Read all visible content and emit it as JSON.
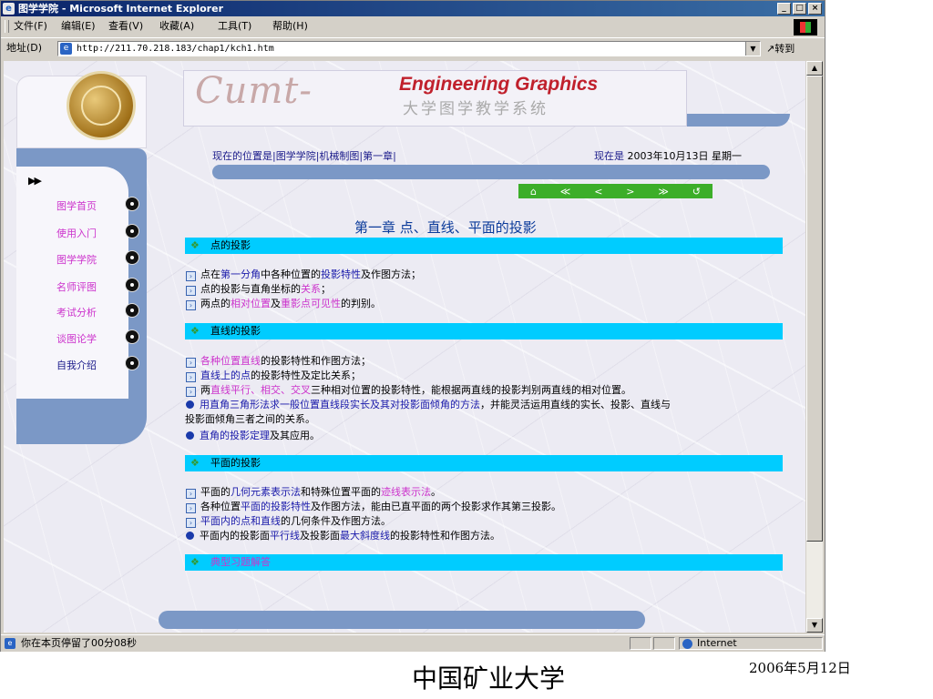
{
  "window": {
    "title": "图学学院 - Microsoft Internet Explorer",
    "min": "_",
    "max": "□",
    "close": "×"
  },
  "menu": [
    "文件(F)",
    "编辑(E)",
    "查看(V)",
    "收藏(A)",
    "工具(T)",
    "帮助(H)"
  ],
  "address": {
    "label": "地址(D)",
    "url": "http://211.70.218.183/chap1/kch1.htm",
    "go": "转到"
  },
  "banner": {
    "script_title": "Cumt-",
    "eg": "Engineering Graphics",
    "cn": "大学图学教学系统"
  },
  "location": {
    "text": "现在的位置是|图学学院|机械制图|第一章|",
    "now_label": "现在是",
    "date": "2003年10月13日  星期一"
  },
  "nav_strip": [
    "⌂",
    "≪",
    "<",
    ">",
    "≫",
    "↺"
  ],
  "sidebar": {
    "arrows": "▶▶",
    "items": [
      {
        "label": "图学首页",
        "current": false
      },
      {
        "label": "使用入门",
        "current": false
      },
      {
        "label": "图学学院",
        "current": false
      },
      {
        "label": "名师评图",
        "current": false
      },
      {
        "label": "考试分析",
        "current": false
      },
      {
        "label": "谈图论学",
        "current": false
      },
      {
        "label": "自我介绍",
        "current": true
      }
    ]
  },
  "chapter_title": "第一章  点、直线、平面的投影",
  "sections": {
    "s1": "点的投影",
    "s2": "直线的投影",
    "s3": "平面的投影",
    "s4": "典型习题解答"
  },
  "lines": {
    "l1": [
      "点在",
      "第一分角",
      "中各种位置的",
      "投影特性",
      "及作图方法；"
    ],
    "l2": [
      "点的投影与直角坐标的",
      "关系",
      "；"
    ],
    "l3": [
      "两点的",
      "相对位置",
      "及",
      "重影点可见性",
      "的判别。"
    ],
    "l4": [
      "各种位置直线",
      "的投影特性和作图方法；"
    ],
    "l5": [
      "直线上的点",
      "的投影特性及定比关系；"
    ],
    "l6": [
      "两",
      "直线平行、相交、交叉",
      "三种相对位置的投影特性，能根据两直线的投影判别两直线的相对位置。"
    ],
    "l7": [
      "用直角三角形法求一般位置直线段实长及其对投影面倾角的方法",
      "，并能灵活运用直线的实长、投影、直线与"
    ],
    "l7b": "投影面倾角三者之间的关系。",
    "l8": [
      "直角的投影定理",
      "及其应用。"
    ],
    "l9": [
      "平面的",
      "几何元素表示法",
      "和特殊位置平面的",
      "迹线表示法",
      "。"
    ],
    "l10": [
      "各种位置",
      "平面的投影特性",
      "及作图方法，能由已直平面的两个投影求作其第三投影。"
    ],
    "l11": [
      "平面内的点和直线",
      "的几何条件及作图方法。"
    ],
    "l12": [
      "平面内的投影面",
      "平行线",
      "及投影面",
      "最大斜度线",
      "的投影特性和作图方法。"
    ]
  },
  "status": {
    "text": "你在本页停留了00分08秒",
    "zone": "Internet"
  },
  "footer": {
    "org": "中国矿业大学",
    "date": "2006年5月12日"
  },
  "colors": {
    "section_bar": "#00ccff",
    "panel_blue": "#7b98c6",
    "link_blue": "#1a1aaa",
    "link_magenta": "#cc33cc"
  }
}
